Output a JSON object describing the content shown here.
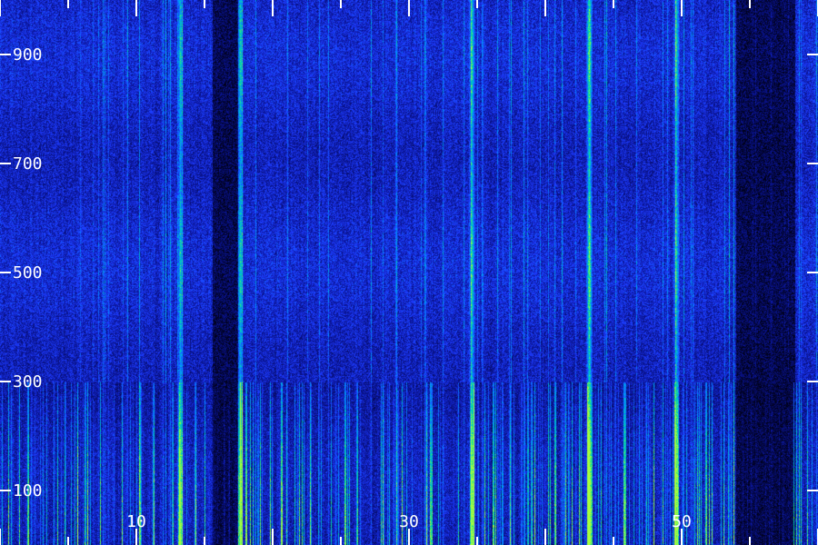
{
  "chart_data": {
    "type": "heatmap",
    "title": "",
    "xlabel": "",
    "ylabel": "",
    "xlim": [
      0,
      60
    ],
    "ylim": [
      0,
      1000
    ],
    "x_tick_labels": [
      "10",
      "30",
      "50"
    ],
    "x_tick_label_values": [
      10,
      30,
      50
    ],
    "x_major_ticks": [
      0,
      10,
      20,
      30,
      40,
      50,
      60
    ],
    "x_minor_ticks": [
      5,
      15,
      25,
      35,
      45,
      55
    ],
    "y_tick_labels": [
      "100",
      "300",
      "500",
      "700",
      "900"
    ],
    "y_tick_values": [
      100,
      300,
      500,
      700,
      900
    ],
    "colormap": [
      "#000020",
      "#0a14a0",
      "#1e3cff",
      "#00a0ff",
      "#00e0a0",
      "#a0ff40"
    ],
    "background_color": "#0a0a7a",
    "noise_floor_boundary_y": 300,
    "strong_lines_x": [
      13.2,
      17.6,
      34.6,
      43.2,
      49.6
    ],
    "dark_bands_x": [
      [
        15.6,
        17.4
      ],
      [
        54.0,
        58.3
      ]
    ],
    "grid": false,
    "legend": "none"
  }
}
